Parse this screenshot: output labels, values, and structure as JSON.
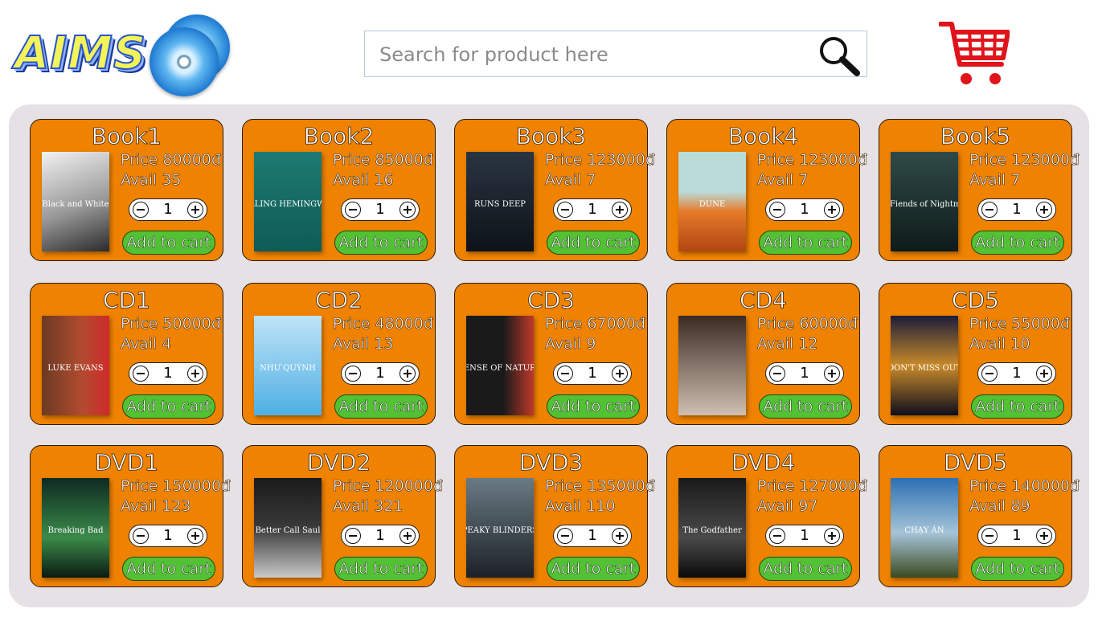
{
  "header": {
    "logo_text": "AIMS",
    "search_placeholder": "Search for product here"
  },
  "colors": {
    "card_bg": "#ef8200",
    "panel_bg": "#e6e1e4",
    "add_button": "#52c234",
    "cart": "#e0141a"
  },
  "icons": {
    "search": "search-icon",
    "cart": "cart-icon",
    "logo": "disc-icon"
  },
  "rows": [
    [
      {
        "title": "Book1",
        "price": "Price 80000đ",
        "avail": "Avail 35",
        "qty": "1",
        "add": "Add to cart"
      },
      {
        "title": "Book2",
        "price": "Price 85000đ",
        "avail": "Avail 16",
        "qty": "1",
        "add": "Add to cart"
      },
      {
        "title": "Book3",
        "price": "Price 123000đ",
        "avail": "Avail 7",
        "qty": "1",
        "add": "Add to cart"
      },
      {
        "title": "Book4",
        "price": "Price 123000đ",
        "avail": "Avail 7",
        "qty": "1",
        "add": "Add to cart"
      },
      {
        "title": "Book5",
        "price": "Price 123000đ",
        "avail": "Avail 7",
        "qty": "1",
        "add": "Add to cart"
      }
    ],
    [
      {
        "title": "CD1",
        "price": "Price 50000đ",
        "avail": "Avail 4",
        "qty": "1",
        "add": "Add to cart"
      },
      {
        "title": "CD2",
        "price": "Price 48000đ",
        "avail": "Avail 13",
        "qty": "1",
        "add": "Add to cart"
      },
      {
        "title": "CD3",
        "price": "Price 67000đ",
        "avail": "Avail 9",
        "qty": "1",
        "add": "Add to cart"
      },
      {
        "title": "CD4",
        "price": "Price 60000đ",
        "avail": "Avail 12",
        "qty": "1",
        "add": "Add to cart"
      },
      {
        "title": "CD5",
        "price": "Price 55000đ",
        "avail": "Avail 10",
        "qty": "1",
        "add": "Add to cart"
      }
    ],
    [
      {
        "title": "DVD1",
        "price": "Price 150000đ",
        "avail": "Avail 123",
        "qty": "1",
        "add": "Add to cart"
      },
      {
        "title": "DVD2",
        "price": "Price 120000đ",
        "avail": "Avail 321",
        "qty": "1",
        "add": "Add to cart"
      },
      {
        "title": "DVD3",
        "price": "Price 135000đ",
        "avail": "Avail 110",
        "qty": "1",
        "add": "Add to cart"
      },
      {
        "title": "DVD4",
        "price": "Price 127000đ",
        "avail": "Avail 97",
        "qty": "1",
        "add": "Add to cart"
      },
      {
        "title": "DVD5",
        "price": "Price 140000đ",
        "avail": "Avail 89",
        "qty": "1",
        "add": "Add to cart"
      }
    ]
  ],
  "thumb_art": [
    [
      {
        "bg": "linear-gradient(160deg,#f2f2f2,#9a9a9a 55%,#2b2b2b)",
        "label": "Black and White"
      },
      {
        "bg": "linear-gradient(180deg,#1d7a72,#0f5b55)",
        "label": "KILLING HEMINGWAY"
      },
      {
        "bg": "linear-gradient(180deg,#2a3542,#0d1218)",
        "label": "RUNS DEEP"
      },
      {
        "bg": "linear-gradient(180deg,#b9dcd8 40%,#e67a2a 60%,#b04612)",
        "label": "DUNE"
      },
      {
        "bg": "linear-gradient(180deg,#2f4a48,#0e1b1a)",
        "label": "The Fiends of Nightmaria"
      }
    ],
    [
      {
        "bg": "linear-gradient(90deg,#6b3a22,#b24b30 60%,#d02a2a)",
        "label": "LUKE EVANS"
      },
      {
        "bg": "linear-gradient(180deg,#bfe3f7,#4fb0e3)",
        "label": "NHƯ QUỲNH"
      },
      {
        "bg": "linear-gradient(90deg,#1a1a1a 55%,#c0392b)",
        "label": "PENSE OF NATURE"
      },
      {
        "bg": "linear-gradient(180deg,#3a2a22,#cfc0b2)",
        "label": ""
      },
      {
        "bg": "linear-gradient(180deg,#1b1d3a,#c98a2a 50%,#0e0e1c)",
        "label": "DON'T MISS OUT"
      }
    ],
    [
      {
        "bg": "linear-gradient(180deg,#0f2a20,#3b8a4a 60%,#0c1a12)",
        "label": "Breaking Bad"
      },
      {
        "bg": "linear-gradient(180deg,#1a1a1a,#3a3a3a 50%,#c9c9c9)",
        "label": "Better Call Saul"
      },
      {
        "bg": "linear-gradient(180deg,#6a7a84,#1c2126)",
        "label": "PEAKY BLINDERS"
      },
      {
        "bg": "linear-gradient(180deg,#1a1a1a,#4a4a4a 60%,#0a0a0a)",
        "label": "The Godfather"
      },
      {
        "bg": "linear-gradient(180deg,#2c6fb3,#a6c4d8 55%,#3a4a20)",
        "label": "CHẠY ÁN"
      }
    ]
  ]
}
